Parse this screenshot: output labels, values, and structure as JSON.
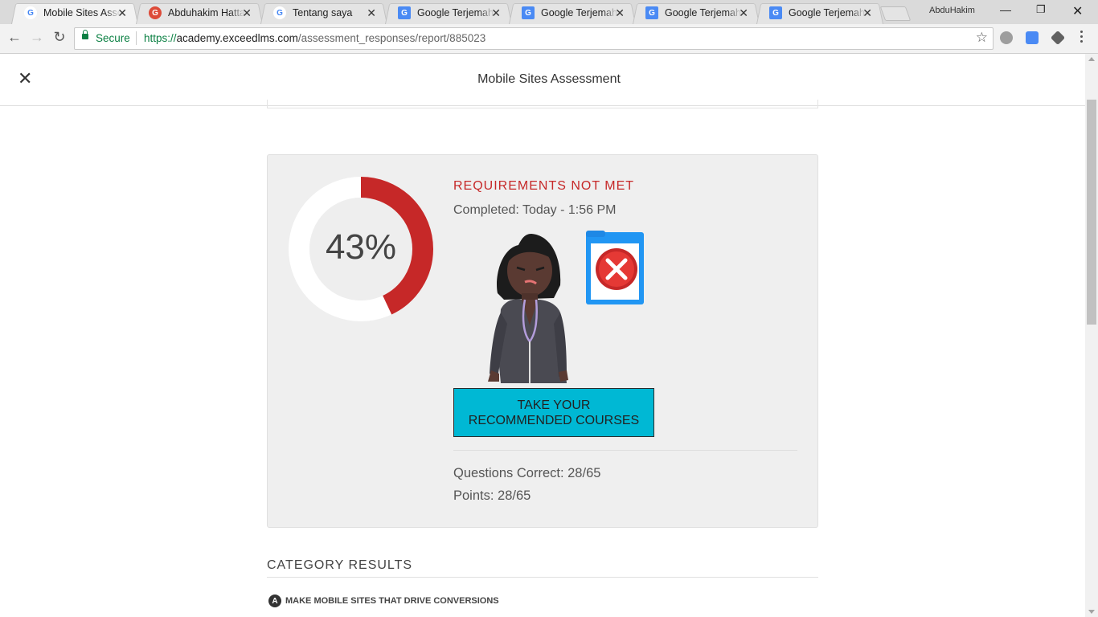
{
  "browser": {
    "tabs": [
      {
        "title": "Mobile Sites Assessment",
        "icon": "google-g-icon",
        "color": "#4285f4",
        "active": true
      },
      {
        "title": "Abduhakim Hattab",
        "icon": "google-plus-icon",
        "color": "#dd4b39",
        "active": false
      },
      {
        "title": "Tentang saya",
        "icon": "google-g-icon",
        "color": "#4285f4",
        "active": false
      },
      {
        "title": "Google Terjemahan",
        "icon": "google-translate-icon",
        "color": "#4a8af4",
        "active": false
      },
      {
        "title": "Google Terjemahan",
        "icon": "google-translate-icon",
        "color": "#4a8af4",
        "active": false
      },
      {
        "title": "Google Terjemahan",
        "icon": "google-translate-icon",
        "color": "#4a8af4",
        "active": false
      },
      {
        "title": "Google Terjemahan",
        "icon": "google-translate-icon",
        "color": "#4a8af4",
        "active": false
      }
    ],
    "profile_name": "AbduHakim",
    "secure_label": "Secure",
    "url_scheme": "https://",
    "url_host": "academy.exceedlms.com",
    "url_path": "/assessment_responses/report/885023"
  },
  "header": {
    "title": "Mobile Sites Assessment"
  },
  "result": {
    "score_label": "43%",
    "score_fraction": 0.43,
    "status": "REQUIREMENTS NOT MET",
    "completed": "Completed: Today - 1:56 PM",
    "cta_line1": "TAKE YOUR",
    "cta_line2": "RECOMMENDED COURSES",
    "questions_correct": "Questions Correct: 28/65",
    "points": "Points: 28/65",
    "colors": {
      "accent_fail": "#c62828",
      "cta": "#00b8d4",
      "ring_bg": "#ffffff"
    }
  },
  "categories": {
    "heading": "CATEGORY RESULTS",
    "items": [
      {
        "badge": "A",
        "label": "MAKE MOBILE SITES THAT DRIVE CONVERSIONS"
      }
    ]
  }
}
